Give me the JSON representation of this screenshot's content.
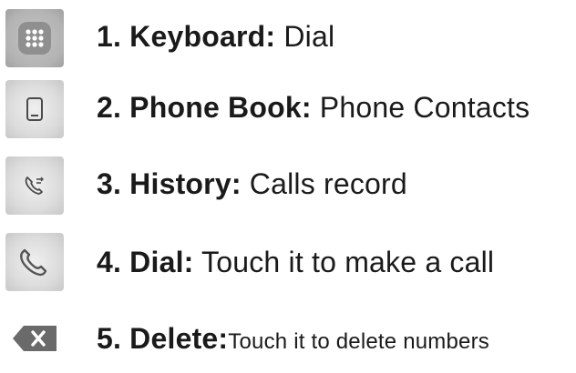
{
  "items": [
    {
      "number_term": "1. Keyboard:",
      "description": " Dial",
      "icon": "keypad-icon"
    },
    {
      "number_term": "2. Phone Book:",
      "description": " Phone Contacts",
      "icon": "phone-book-icon"
    },
    {
      "number_term": "3. History:",
      "description": " Calls record",
      "icon": "call-history-icon"
    },
    {
      "number_term": "4. Dial:",
      "description": " Touch it to make a call",
      "icon": "dial-handset-icon"
    },
    {
      "number_term": "5. Delete:",
      "description": "Touch it to delete numbers",
      "icon": "delete-backspace-icon"
    }
  ],
  "colors": {
    "text": "#1a1a1a",
    "icon_bg": "#d9d9d9",
    "icon_glyph": "#555555"
  }
}
